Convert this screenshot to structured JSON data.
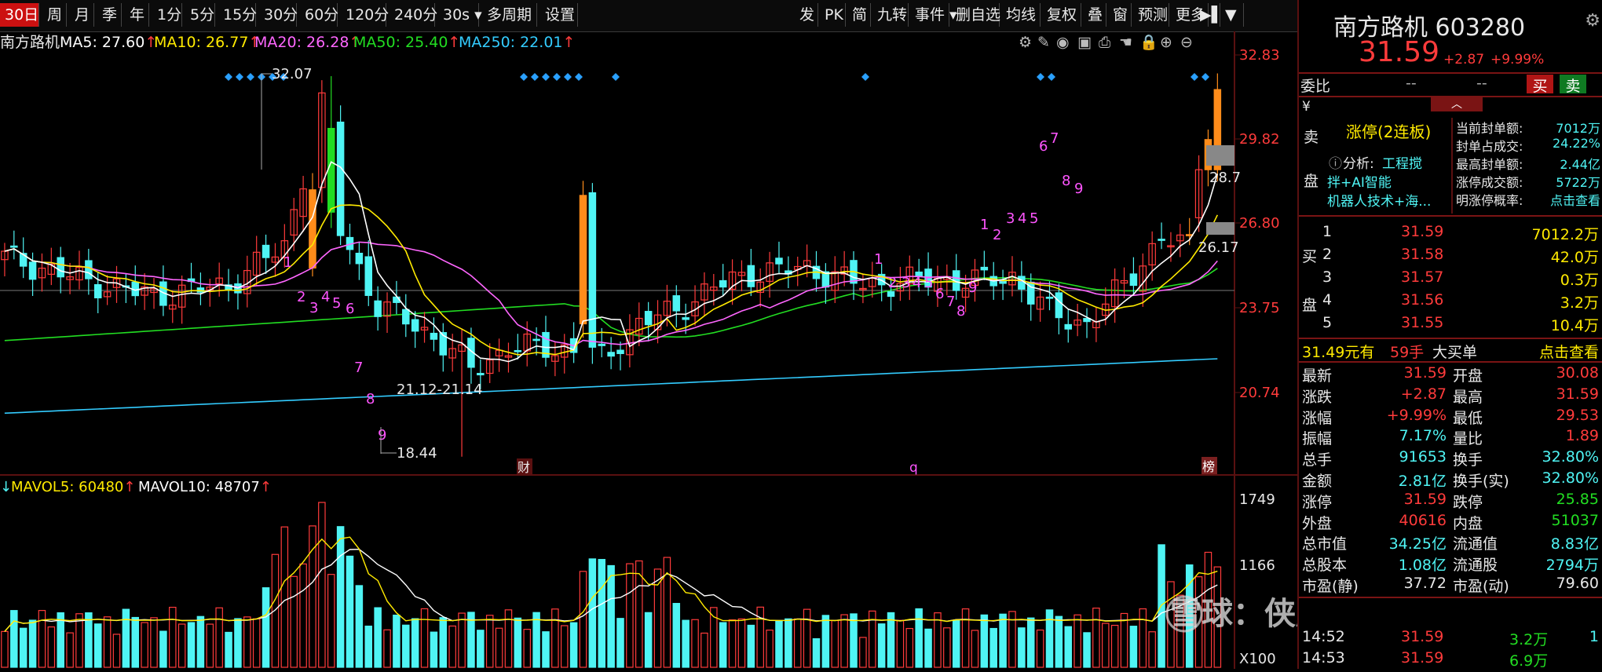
{
  "toolbar": {
    "periods": [
      {
        "label": "30日",
        "active": true
      },
      {
        "label": "周"
      },
      {
        "label": "月"
      },
      {
        "label": "季"
      },
      {
        "label": "年"
      },
      {
        "label": "1分"
      },
      {
        "label": "5分"
      },
      {
        "label": "15分"
      },
      {
        "label": "30分"
      },
      {
        "label": "60分"
      },
      {
        "label": "120分"
      },
      {
        "label": "240分"
      },
      {
        "label": "30s"
      },
      {
        "label": "多周期"
      },
      {
        "label": "设置"
      }
    ],
    "right_tools": [
      {
        "label": "发"
      },
      {
        "label": "PK"
      },
      {
        "label": "简"
      },
      {
        "label": "九转"
      },
      {
        "label": "事件"
      },
      {
        "label": "删自选"
      },
      {
        "label": "均线"
      },
      {
        "label": "复权"
      },
      {
        "label": "叠"
      },
      {
        "label": "窗"
      },
      {
        "label": "预测"
      },
      {
        "label": "更多"
      }
    ]
  },
  "ma_legend": {
    "stock": "南方路机",
    "items": [
      {
        "label": "MA5: 27.60",
        "arrow": "↑",
        "color": "#ffffff"
      },
      {
        "label": "MA10: 26.77",
        "arrow": "↑",
        "color": "#ffea00"
      },
      {
        "label": "MA20: 26.28",
        "arrow": "↑",
        "color": "#ff66ff"
      },
      {
        "label": "MA50: 25.40",
        "arrow": "↑",
        "color": "#22dd22"
      },
      {
        "label": "MA250: 22.01",
        "arrow": "↑",
        "color": "#33ccff"
      }
    ]
  },
  "price_axis": [
    "32.83",
    "29.82",
    "26.80",
    "23.75",
    "20.74"
  ],
  "volume_axis": [
    "1749",
    "1166",
    "X100"
  ],
  "annotations": {
    "high": "32.07",
    "low": "18.44",
    "range": "21.12-21.14",
    "level1": "28.7",
    "level2": "26.17",
    "marker_cai": "财",
    "marker_q": "q",
    "marker_bang": "榜",
    "nine_labels": [
      {
        "t": "1"
      },
      {
        "t": "2"
      },
      {
        "t": "3"
      },
      {
        "t": "4"
      },
      {
        "t": "5"
      },
      {
        "t": "6"
      },
      {
        "t": "7"
      },
      {
        "t": "8"
      },
      {
        "t": "9"
      },
      {
        "t": "1"
      },
      {
        "t": "2"
      },
      {
        "t": "3"
      },
      {
        "t": "4"
      },
      {
        "t": "5"
      },
      {
        "t": "6"
      },
      {
        "t": "7"
      },
      {
        "t": "8"
      },
      {
        "t": "9"
      },
      {
        "t": "1"
      },
      {
        "t": "2"
      },
      {
        "t": "3"
      },
      {
        "t": "4"
      },
      {
        "t": "5"
      },
      {
        "t": "6"
      },
      {
        "t": "7"
      },
      {
        "t": "8"
      },
      {
        "t": "9"
      }
    ]
  },
  "vol_legend": {
    "items": [
      {
        "label": "MAVOL5: 60480",
        "arrow": "↑",
        "color": "#ffea00"
      },
      {
        "label": "MAVOL10: 48707",
        "arrow": "↑",
        "color": "#ffffff"
      }
    ]
  },
  "watermark": "雪球：侠股新秀",
  "quote": {
    "title": "南方路机 603280",
    "price": "31.59",
    "change": "+2.87",
    "pct": "+9.99%",
    "weibi_label": "委比",
    "weibi_v1": "--",
    "weibi_v2": "--",
    "buy_btn": "买",
    "sell_btn": "卖",
    "limit_status": "涨停(2连板)",
    "analysis_label": "分析:",
    "analysis_text": [
      "工程搅",
      "拌+AI智能",
      "机器人技术+海..."
    ],
    "seal_stats": [
      {
        "label": "当前封单额:",
        "value": "7012万"
      },
      {
        "label": "封单占成交:",
        "value": "24.22%"
      },
      {
        "label": "最高封单额:",
        "value": "2.44亿"
      },
      {
        "label": "涨停成交额:",
        "value": "5722万"
      },
      {
        "label": "明涨停概率:",
        "value": "点击查看"
      }
    ],
    "sell_side_labels": [
      "卖",
      "盘"
    ],
    "buy_side_labels": [
      "买",
      "盘"
    ],
    "bids": [
      {
        "level": "1",
        "price": "31.59",
        "vol": "7012.2万"
      },
      {
        "level": "2",
        "price": "31.58",
        "vol": "42.0万"
      },
      {
        "level": "3",
        "price": "31.57",
        "vol": "0.3万"
      },
      {
        "level": "4",
        "price": "31.56",
        "vol": "3.2万"
      },
      {
        "level": "5",
        "price": "31.55",
        "vol": "10.4万"
      }
    ],
    "big_order": {
      "price": "31.49元有",
      "qty": "59手",
      "label": "大买单",
      "link": "点击查看"
    },
    "stats": [
      {
        "l1": "最新",
        "v1": "31.59",
        "c1": "red",
        "l2": "开盘",
        "v2": "30.08",
        "c2": "red"
      },
      {
        "l1": "涨跌",
        "v1": "+2.87",
        "c1": "red",
        "l2": "最高",
        "v2": "31.59",
        "c2": "red"
      },
      {
        "l1": "涨幅",
        "v1": "+9.99%",
        "c1": "red",
        "l2": "最低",
        "v2": "29.53",
        "c2": "red"
      },
      {
        "l1": "振幅",
        "v1": "7.17%",
        "c1": "cyan",
        "l2": "量比",
        "v2": "1.89",
        "c2": "red"
      },
      {
        "l1": "总手",
        "v1": "91653",
        "c1": "cyan",
        "l2": "换手",
        "v2": "32.80%",
        "c2": "cyan"
      },
      {
        "l1": "金额",
        "v1": "2.81亿",
        "c1": "cyan",
        "l2": "换手(实)",
        "v2": "32.80%",
        "c2": "cyan"
      },
      {
        "l1": "涨停",
        "v1": "31.59",
        "c1": "red",
        "l2": "跌停",
        "v2": "25.85",
        "c2": "green"
      },
      {
        "l1": "外盘",
        "v1": "40616",
        "c1": "red",
        "l2": "内盘",
        "v2": "51037",
        "c2": "green"
      },
      {
        "l1": "总市值",
        "v1": "34.25亿",
        "c1": "cyan",
        "l2": "流通值",
        "v2": "8.83亿",
        "c2": "cyan"
      },
      {
        "l1": "总股本",
        "v1": "1.08亿",
        "c1": "cyan",
        "l2": "流通股",
        "v2": "2794万",
        "c2": "cyan"
      },
      {
        "l1": "市盈(静)",
        "v1": "37.72",
        "c1": "white",
        "l2": "市盈(动)",
        "v2": "79.60",
        "c2": "white"
      }
    ],
    "ticks": [
      {
        "time": "14:52",
        "price": "31.59",
        "vol": "3.2万",
        "n": "1"
      },
      {
        "time": "14:53",
        "price": "31.59",
        "vol": "6.9万",
        "n": ""
      }
    ]
  },
  "colors": {
    "up": "#ff3b3b",
    "down": "#4ff4f4",
    "bg": "#000000",
    "limit": "#ff8c1a"
  }
}
